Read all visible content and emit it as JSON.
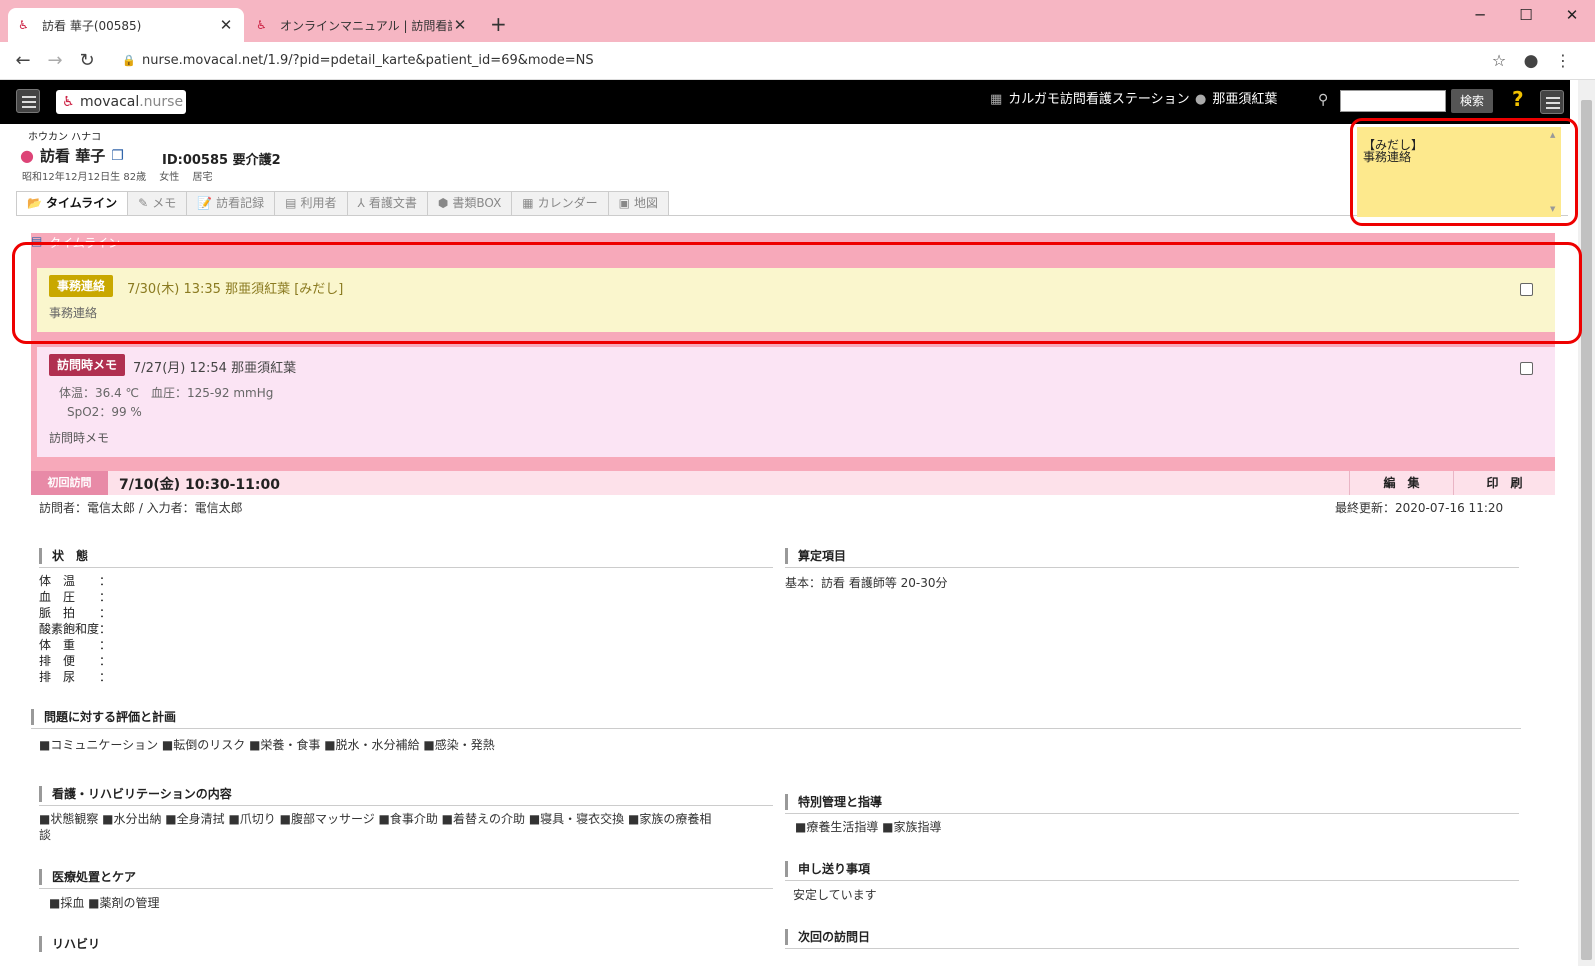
{
  "browser": {
    "tabs": [
      {
        "title": "訪看 華子(00585)",
        "active": true
      },
      {
        "title": "オンラインマニュアル | 訪問看護対応",
        "active": false
      }
    ],
    "url": "nurse.movacal.net/1.9/?pid=pdetail_karte&patient_id=69&mode=NS",
    "new_tab": "+",
    "window_controls": [
      "─",
      "☐",
      "✕"
    ]
  },
  "app": {
    "logo_main": "movacal",
    "logo_sub": ".nurse",
    "station": "カルガモ訪問看護ステーション",
    "staff": "那亜須紅葉",
    "search_button": "検索",
    "help": "?"
  },
  "patient": {
    "kana": "ホウカン ハナコ",
    "name": "訪看 華子",
    "id_care": "ID:00585 要介護2",
    "birth": "昭和12年12月12日生 82歳",
    "sex": "女性",
    "residence": "居宅"
  },
  "tabs": [
    {
      "label": "タイムライン",
      "icon": "📂",
      "active": true
    },
    {
      "label": "メモ",
      "icon": "✎",
      "active": false
    },
    {
      "label": "訪看記録",
      "icon": "📝",
      "active": false
    },
    {
      "label": "利用者",
      "icon": "▤",
      "active": false
    },
    {
      "label": "看護文書",
      "icon": "⅄",
      "active": false
    },
    {
      "label": "書類BOX",
      "icon": "⬢",
      "active": false
    },
    {
      "label": "カレンダー",
      "icon": "▦",
      "active": false
    },
    {
      "label": "地図",
      "icon": "▣",
      "active": false
    }
  ],
  "note": {
    "line1": "【みだし】",
    "line2": "事務連絡"
  },
  "timeline": {
    "header": "タイムライン",
    "card1": {
      "badge": "事務連絡",
      "head": "7/30(木) 13:35 那亜須紅葉 [みだし]",
      "body": "事務連絡"
    },
    "card2": {
      "badge": "訪問時メモ",
      "head": "7/27(月) 12:54 那亜須紅葉",
      "vitals1": "体温：36.4 ℃　血圧：125-92 mmHg",
      "vitals2": "SpO2：99 %",
      "body": "訪問時メモ"
    }
  },
  "visit": {
    "badge": "初回訪問",
    "date": "7/10(金) 10:30-11:00",
    "edit": "編　集",
    "print": "印　刷",
    "visitor": "訪問者：電信太郎 / 入力者：電信太郎",
    "updated": "最終更新：2020-07-16 11:20",
    "status_title": "状　態",
    "status_items": [
      "体　温　　：",
      "血　圧　　：",
      "脈　拍　　：",
      "酸素飽和度：",
      "体　重　　：",
      "排　便　　：",
      "排　尿　　："
    ],
    "calc_title": "算定項目",
    "calc_value": "基本：訪看 看護師等 20-30分",
    "eval_title": "問題に対する評価と計画",
    "eval_value": "■コミュニケーション ■転倒のリスク ■栄養・食事 ■脱水・水分補給 ■感染・発熱",
    "care_title": "看護・リハビリテーションの内容",
    "care_value1": "■状態観察 ■水分出納 ■全身清拭 ■爪切り ■腹部マッサージ ■食事介助 ■着替えの介助 ■寝具・寝衣交換 ■家族の療養相",
    "care_value2": "談",
    "special_title": "特別管理と指導",
    "special_value": "■療養生活指導 ■家族指導",
    "med_title": "医療処置とケア",
    "med_value": "■採血 ■薬剤の管理",
    "handover_title": "申し送り事項",
    "handover_value": "安定しています",
    "rehab_title": "リハビリ",
    "next_title": "次回の訪問日"
  }
}
